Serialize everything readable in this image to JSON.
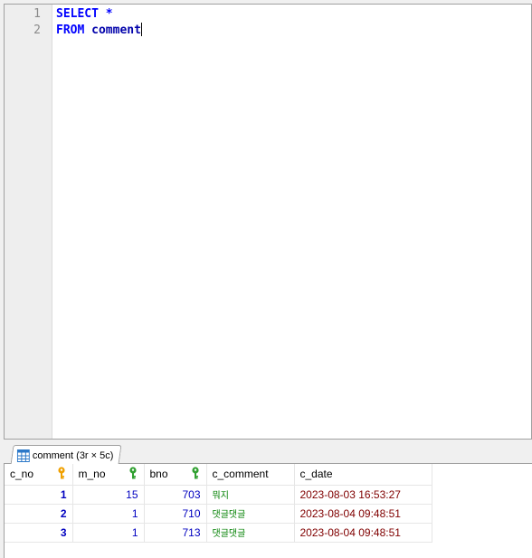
{
  "editor": {
    "lines": [
      {
        "number": "1",
        "tokens": [
          {
            "text": "SELECT",
            "kind": "kw"
          },
          {
            "text": " ",
            "kind": "sp"
          },
          {
            "text": "*",
            "kind": "op"
          }
        ]
      },
      {
        "number": "2",
        "tokens": [
          {
            "text": "FROM",
            "kind": "kw"
          },
          {
            "text": " ",
            "kind": "sp"
          },
          {
            "text": "comment",
            "kind": "ident"
          }
        ]
      }
    ]
  },
  "result_tab": {
    "label": "comment (3r × 5c)",
    "icon": "table-grid-icon"
  },
  "grid": {
    "columns": [
      {
        "name": "c_no",
        "key": "primary",
        "key_color": "#f0a000"
      },
      {
        "name": "m_no",
        "key": "foreign",
        "key_color": "#30a030"
      },
      {
        "name": "bno",
        "key": "foreign",
        "key_color": "#30a030"
      },
      {
        "name": "c_comment",
        "key": "none"
      },
      {
        "name": "c_date",
        "key": "none"
      }
    ],
    "rows": [
      [
        "1",
        "15",
        "703",
        "뭐지",
        "2023-08-03 16:53:27"
      ],
      [
        "2",
        "1",
        "710",
        "댓글댓글",
        "2023-08-04 09:48:51"
      ],
      [
        "3",
        "1",
        "713",
        "댓글댓글",
        "2023-08-04 09:48:51"
      ]
    ]
  },
  "colors": {
    "keyword": "#0000ff",
    "number": "#0000c0",
    "text": "#008000",
    "date": "#800000"
  }
}
